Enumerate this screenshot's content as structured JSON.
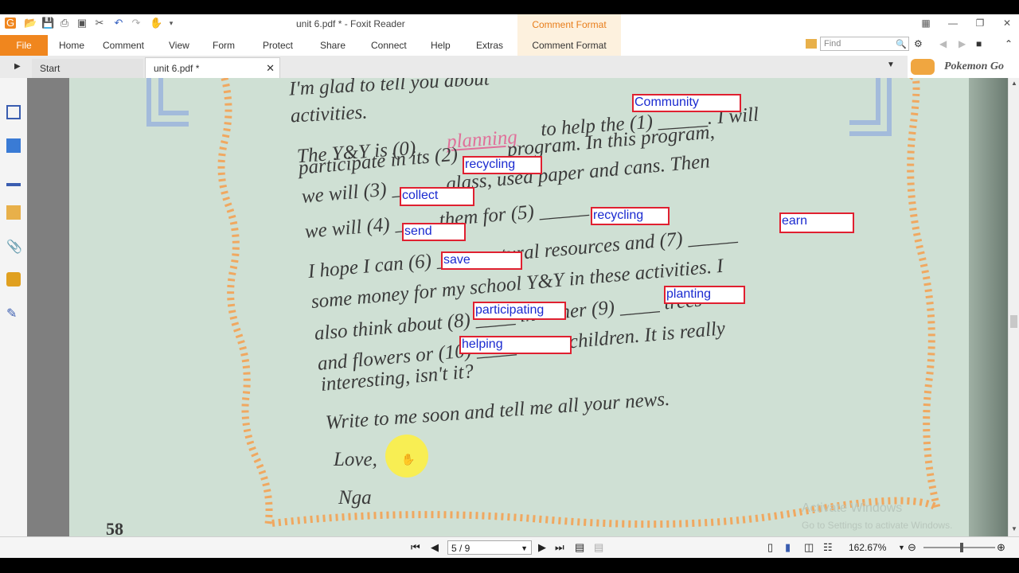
{
  "window": {
    "title": "unit 6.pdf * - Foxit Reader",
    "context_tab_title": "Comment Format"
  },
  "ribbon": {
    "file": "File",
    "tabs": [
      "Home",
      "Comment",
      "View",
      "Form",
      "Protect",
      "Share",
      "Connect",
      "Help",
      "Extras"
    ],
    "context_tab": "Comment Format",
    "find_placeholder": "Find"
  },
  "tabs": {
    "start": "Start",
    "document": "unit 6.pdf *"
  },
  "ad": {
    "text": "Pokemon Go"
  },
  "document": {
    "lines": [
      "I'm glad to tell you about",
      "activities.",
      "The Y&Y is (0)",
      "planning",
      "to help the (1) _____. I will",
      "participate in its (2) ____ program.  In this program,",
      "we will (3) _____ glass, used paper and cans.  Then",
      "we will (4) ____ them for (5) _____",
      "I hope I can (6) ____ natural resources and (7) _____",
      "some money for my school Y&Y in these activities. I",
      "also think about (8) ____ in either (9) ____ trees",
      "and flowers or (10) ____ street children.  It is really",
      "interesting, isn't it?",
      "Write to me soon and tell me all your news.",
      "Love,",
      "Nga"
    ],
    "page_number": "58",
    "annotations": [
      "Community",
      "recycling",
      "collect",
      "send",
      "recycling",
      "earn",
      "save",
      "participating",
      "planting",
      "helping"
    ]
  },
  "watermark": {
    "line1": "Activate Windows",
    "line2": "Go to Settings to activate Windows."
  },
  "status": {
    "page": "5 / 9",
    "zoom": "162.67%"
  }
}
